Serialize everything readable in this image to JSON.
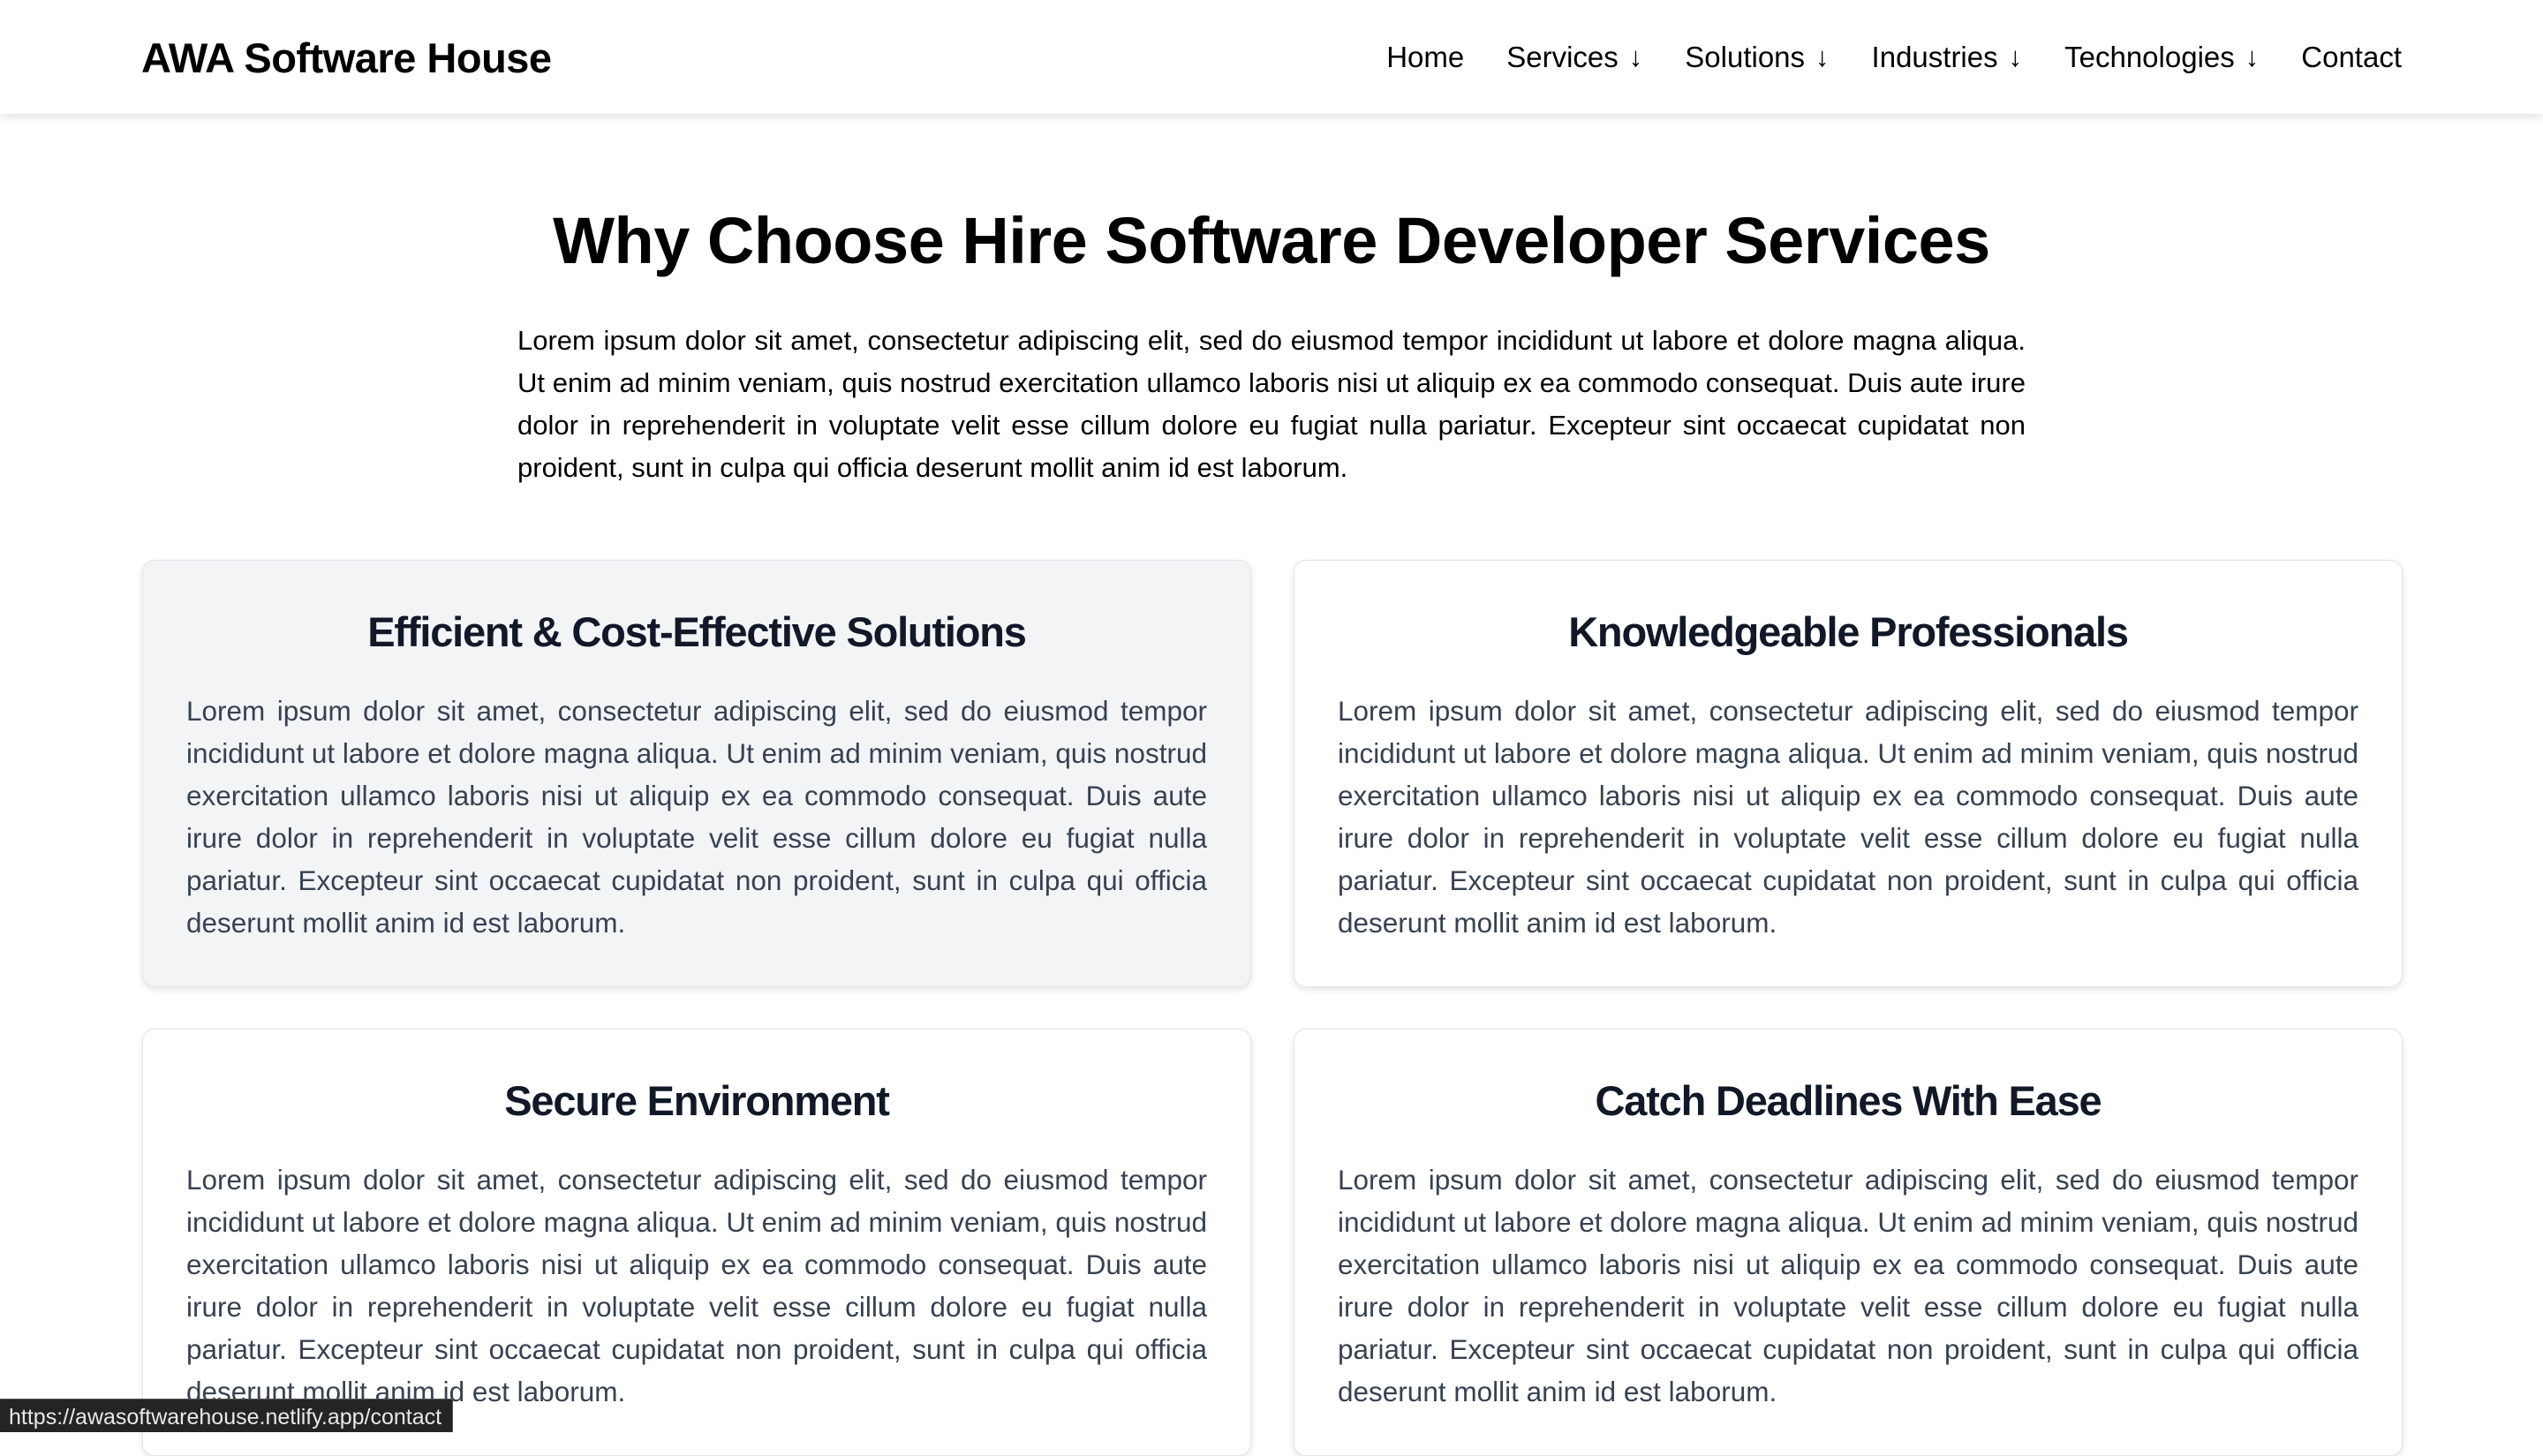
{
  "header": {
    "brand": "AWA Software House",
    "nav": [
      {
        "label": "Home",
        "has_dropdown": false
      },
      {
        "label": "Services",
        "has_dropdown": true
      },
      {
        "label": "Solutions",
        "has_dropdown": true
      },
      {
        "label": "Industries",
        "has_dropdown": true
      },
      {
        "label": "Technologies",
        "has_dropdown": true
      },
      {
        "label": "Contact",
        "has_dropdown": false
      }
    ],
    "dropdown_arrow": "↓"
  },
  "section": {
    "title": "Why Choose Hire Software Developer Services",
    "intro": "Lorem ipsum dolor sit amet, consectetur adipiscing elit, sed do eiusmod tempor incididunt ut labore et dolore magna aliqua. Ut enim ad minim veniam, quis nostrud exercitation ullamco laboris nisi ut aliquip ex ea commodo consequat. Duis aute irure dolor in reprehenderit in voluptate velit esse cillum dolore eu fugiat nulla pariatur. Excepteur sint occaecat cupidatat non proident, sunt in culpa qui officia deserunt mollit anim id est laborum."
  },
  "cards": [
    {
      "title": "Efficient & Cost-Effective Solutions",
      "body": "Lorem ipsum dolor sit amet, consectetur adipiscing elit, sed do eiusmod tempor incididunt ut labore et dolore magna aliqua. Ut enim ad minim veniam, quis nostrud exercitation ullamco laboris nisi ut aliquip ex ea commodo consequat. Duis aute irure dolor in reprehenderit in voluptate velit esse cillum dolore eu fugiat nulla pariatur. Excepteur sint occaecat cupidatat non proident, sunt in culpa qui officia deserunt mollit anim id est laborum."
    },
    {
      "title": "Knowledgeable Professionals",
      "body": "Lorem ipsum dolor sit amet, consectetur adipiscing elit, sed do eiusmod tempor incididunt ut labore et dolore magna aliqua. Ut enim ad minim veniam, quis nostrud exercitation ullamco laboris nisi ut aliquip ex ea commodo consequat. Duis aute irure dolor in reprehenderit in voluptate velit esse cillum dolore eu fugiat nulla pariatur. Excepteur sint occaecat cupidatat non proident, sunt in culpa qui officia deserunt mollit anim id est laborum."
    },
    {
      "title": "Secure Environment",
      "body": "Lorem ipsum dolor sit amet, consectetur adipiscing elit, sed do eiusmod tempor incididunt ut labore et dolore magna aliqua. Ut enim ad minim veniam, quis nostrud exercitation ullamco laboris nisi ut aliquip ex ea commodo consequat. Duis aute irure dolor in reprehenderit in voluptate velit esse cillum dolore eu fugiat nulla pariatur. Excepteur sint occaecat cupidatat non proident, sunt in culpa qui officia deserunt mollit anim id est laborum."
    },
    {
      "title": "Catch Deadlines With Ease",
      "body": "Lorem ipsum dolor sit amet, consectetur adipiscing elit, sed do eiusmod tempor incididunt ut labore et dolore magna aliqua. Ut enim ad minim veniam, quis nostrud exercitation ullamco laboris nisi ut aliquip ex ea commodo consequat. Duis aute irure dolor in reprehenderit in voluptate velit esse cillum dolore eu fugiat nulla pariatur. Excepteur sint occaecat cupidatat non proident, sunt in culpa qui officia deserunt mollit anim id est laborum."
    }
  ],
  "status_bar": {
    "url": "https://awasoftwarehouse.netlify.app/contact"
  },
  "colors": {
    "highlight_card_bg": "#f3f4f6",
    "card_title": "#111827",
    "card_text": "#374151"
  }
}
